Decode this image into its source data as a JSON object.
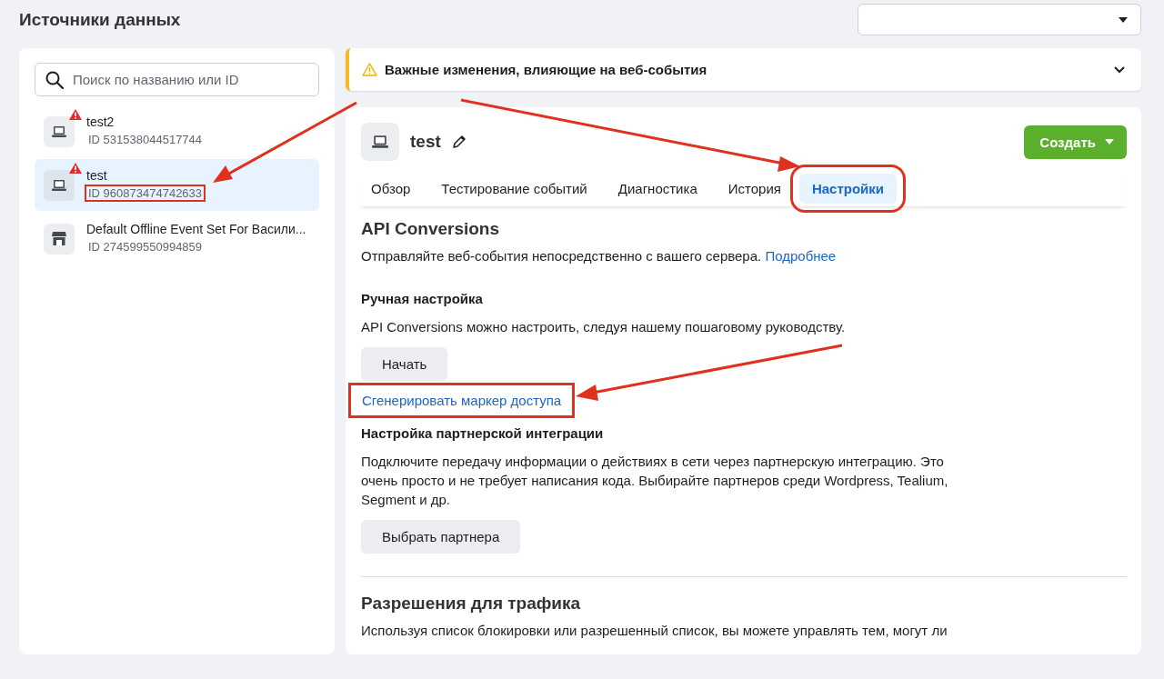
{
  "page_title": "Источники данных",
  "search": {
    "placeholder": "Поиск по названию или ID"
  },
  "sources": [
    {
      "name": "test2",
      "id": "ID 531538044517744",
      "kind": "laptop",
      "warning": true,
      "selected": false,
      "id_highlighted": false
    },
    {
      "name": "test",
      "id": "ID 960873474742633",
      "kind": "laptop",
      "warning": true,
      "selected": true,
      "id_highlighted": true
    },
    {
      "name": "Default Offline Event Set For Васили...",
      "id": "ID 274599550994859",
      "kind": "store",
      "warning": false,
      "selected": false,
      "id_highlighted": false
    }
  ],
  "notice": {
    "title": "Важные изменения, влияющие на веб-события",
    "expanded": false
  },
  "source_header": {
    "name": "test",
    "create_button": "Создать"
  },
  "tabs": [
    {
      "label": "Обзор",
      "selected": false,
      "highlighted": false
    },
    {
      "label": "Тестирование событий",
      "selected": false,
      "highlighted": false
    },
    {
      "label": "Диагностика",
      "selected": false,
      "highlighted": false
    },
    {
      "label": "История",
      "selected": false,
      "highlighted": false
    },
    {
      "label": "Настройки",
      "selected": true,
      "highlighted": true
    }
  ],
  "blocks": [
    {
      "kind": "heading",
      "text": "API Conversions"
    },
    {
      "kind": "text",
      "text": "Отправляйте веб-события непосредственно с вашего сервера.",
      "link": "Подробнее"
    },
    {
      "kind": "subheading",
      "text": "Ручная настройка"
    },
    {
      "kind": "text",
      "text": "API Conversions можно настроить, следуя нашему пошаговому руководству."
    },
    {
      "kind": "button",
      "text": "Начать"
    },
    {
      "kind": "link",
      "text": "Сгенерировать маркер доступа",
      "highlighted": true
    },
    {
      "kind": "subheading",
      "text": "Настройка партнерской интеграции"
    },
    {
      "kind": "text",
      "text": "Подключите передачу информации о действиях в сети через партнерскую интеграцию. Это очень просто и не требует написания кода. Выбирайте партнеров среди Wordpress, Tealium, Segment и др."
    },
    {
      "kind": "button",
      "text": "Выбрать партнера"
    },
    {
      "kind": "divider"
    },
    {
      "kind": "heading",
      "text": "Разрешения для трафика"
    },
    {
      "kind": "text",
      "text": "Используя список блокировки или разрешенный список, вы можете управлять тем, могут ли"
    }
  ]
}
